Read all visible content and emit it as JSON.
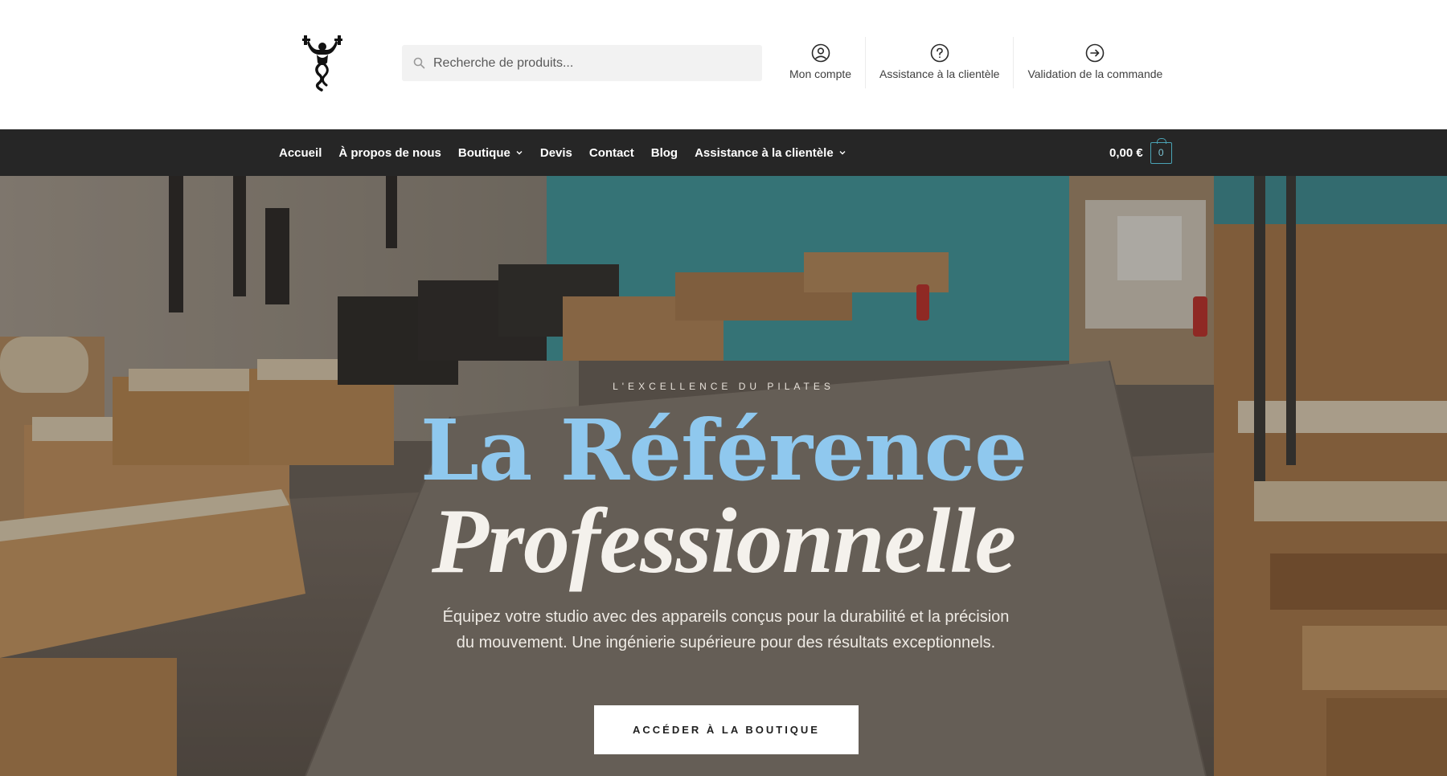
{
  "search": {
    "placeholder": "Recherche de produits..."
  },
  "header_links": [
    {
      "label": "Mon compte",
      "icon": "user-circle-icon"
    },
    {
      "label": "Assistance à la clientèle",
      "icon": "question-circle-icon"
    },
    {
      "label": "Validation de la commande",
      "icon": "arrow-right-circle-icon"
    }
  ],
  "nav": {
    "items": [
      {
        "label": "Accueil",
        "has_dropdown": false
      },
      {
        "label": "À propos de nous",
        "has_dropdown": false
      },
      {
        "label": "Boutique",
        "has_dropdown": true
      },
      {
        "label": "Devis",
        "has_dropdown": false
      },
      {
        "label": "Contact",
        "has_dropdown": false
      },
      {
        "label": "Blog",
        "has_dropdown": false
      },
      {
        "label": "Assistance à la clientèle",
        "has_dropdown": true
      }
    ],
    "cart_total": "0,00 €",
    "cart_count": "0"
  },
  "hero": {
    "eyebrow": "L'EXCELLENCE DU PILATES",
    "title_line1": "La Référence",
    "title_line2": "Professionnelle",
    "description": "Équipez votre studio avec des appareils conçus pour la durabilité et la précision du mouvement. Une ingénierie supérieure pour des résultats exceptionnels.",
    "cta": "ACCÉDER À LA BOUTIQUE"
  },
  "colors": {
    "nav_background": "#262626",
    "accent_blue": "#8fc8ee",
    "cart_accent": "#4aa3b5",
    "search_background": "#f2f2f2"
  }
}
